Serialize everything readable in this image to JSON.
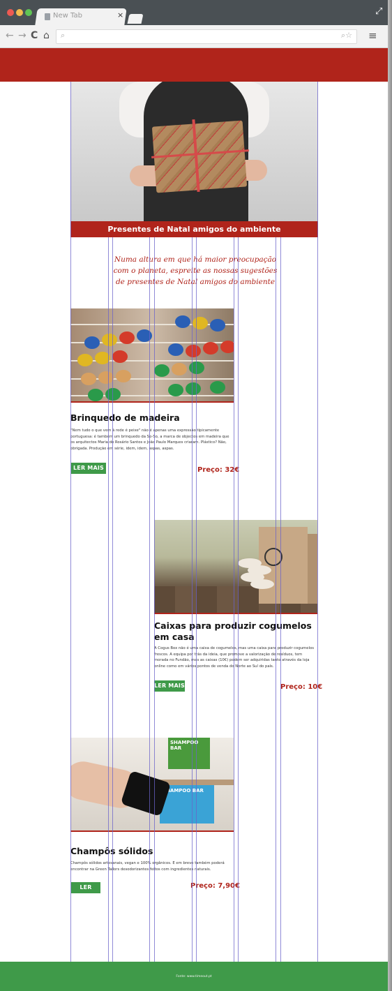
{
  "browser": {
    "tab_title": "New Tab",
    "tab_close": "×",
    "nav_back": "←",
    "nav_forward": "→",
    "nav_reload": "C",
    "nav_home": "⌂",
    "search_glyph": "⌕",
    "omnibox_right": "⌕☆",
    "menu_glyph": "≡",
    "fullscreen_glyph": "⤢",
    "url_value": ""
  },
  "hero": {
    "banner": "Presentes de Natal amigos do ambiente",
    "intro": "Numa altura em que há maior preocupação com o planeta, espreite as nossas sugestões de presentes de Natal amigos do ambiente"
  },
  "products": [
    {
      "title": "Brinquedo de madeira",
      "text": "\"Nem tudo o que vem à rede é peixe\" não é apenas uma expressão tipicamente portuguesa: é também um brinquedo da So-So, a marca de objectos em madeira que os arquitectos Maria do Rosário Santos e João Paulo Marques criaram. Plástico? Não, obrigada. Produção em série, idem, idem, aspas, aspas.",
      "button": "LER MAIS",
      "price": "Preço: 32€"
    },
    {
      "title": "Caixas para produzir cogumelos em casa",
      "text": "A Cogus Box não é uma caixa de cogumelos, mas uma caixa para produzir cogumelos frescos. A equipa por trás da ideia, que promove a valorização de resíduos, tem morada no Fundão, mas as caixas (10€) podem ser adquiridas tanto através da loja online como em vários pontos de venda do Norte ao Sul do país.",
      "button": "LER MAIS",
      "price": "Preço: 10€"
    },
    {
      "title": "Champôs sólidos",
      "text": "Champôs sólidos artesanais, vegan e 100% orgânicos. E em breve também poderá encontrar na Green Tailors desodorizantes feitos com ingredientes naturais.",
      "button": "LER MAIS",
      "price": "Preço: 7,90€"
    }
  ],
  "soap_labels": {
    "box1": "SHAMPOO BAR",
    "box2": "SHAMPOO BAR"
  },
  "footer": {
    "text": "Fonte: www.timeout.pt"
  },
  "colors": {
    "brand_red": "#b0241b",
    "brand_green": "#3f9a49"
  }
}
